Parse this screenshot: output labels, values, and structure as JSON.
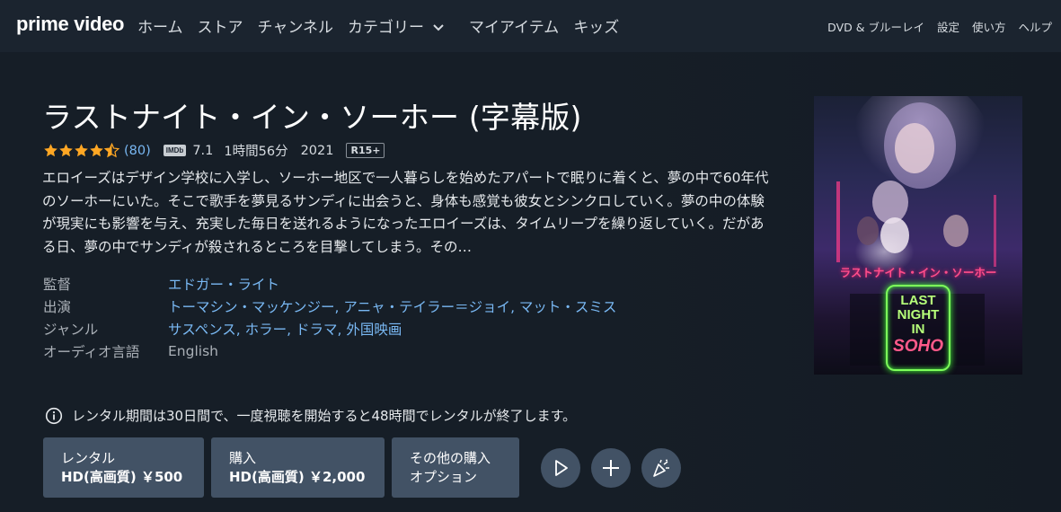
{
  "nav": {
    "logo": "prime video",
    "items": [
      "ホーム",
      "ストア",
      "チャンネル",
      "カテゴリー",
      "マイアイテム",
      "キッズ"
    ],
    "utility": [
      "DVD & ブルーレイ",
      "設定",
      "使い方",
      "ヘルプ"
    ]
  },
  "movie": {
    "title": "ラストナイト・イン・ソーホー (字幕版)",
    "rating_stars": 4.5,
    "review_count": "(80)",
    "imdb_badge": "IMDb",
    "imdb_score": "7.1",
    "runtime": "1時間56分",
    "year": "2021",
    "age_rating": "R15+",
    "synopsis": "エロイーズはデザイン学校に入学し、ソーホー地区で一人暮らしを始めたアパートで眠りに着くと、夢の中で60年代のソーホーにいた。そこで歌手を夢見るサンディに出会うと、身体も感覚も彼女とシンクロしていく。夢の中の体験が現実にも影響を与え、充実した毎日を送れるようになったエロイーズは、タイムリープを繰り返していく。だがある日、夢の中でサンディが殺されるところを目撃してしまう。その…",
    "details": [
      {
        "label": "監督",
        "value": "エドガー・ライト"
      },
      {
        "label": "出演",
        "value": "トーマシン・マッケンジー, アニャ・テイラー＝ジョイ, マット・スミス"
      },
      {
        "label": "ジャンル",
        "value": "サスペンス, ホラー, ドラマ, 外国映画"
      },
      {
        "label": "オーディオ言語",
        "value": "English"
      }
    ],
    "poster_title": "ラストナイト・イン・ソーホー",
    "poster_neon": [
      "LAST",
      "NIGHT",
      "IN",
      "SOHO"
    ]
  },
  "notice": "レンタル期間は30日間で、一度視聴を開始すると48時間でレンタルが終了します。",
  "actions": {
    "rent_label": "レンタル",
    "rent_price": "HD(高画質) ￥500",
    "buy_label": "購入",
    "buy_price": "HD(高画質) ￥2,000",
    "other_line1": "その他の購入",
    "other_line2": "オプション"
  },
  "colors": {
    "background": "#131a22",
    "nav_background": "#1b242f",
    "link": "#79b8f3",
    "button": "#425265",
    "star": "#ffa724"
  }
}
